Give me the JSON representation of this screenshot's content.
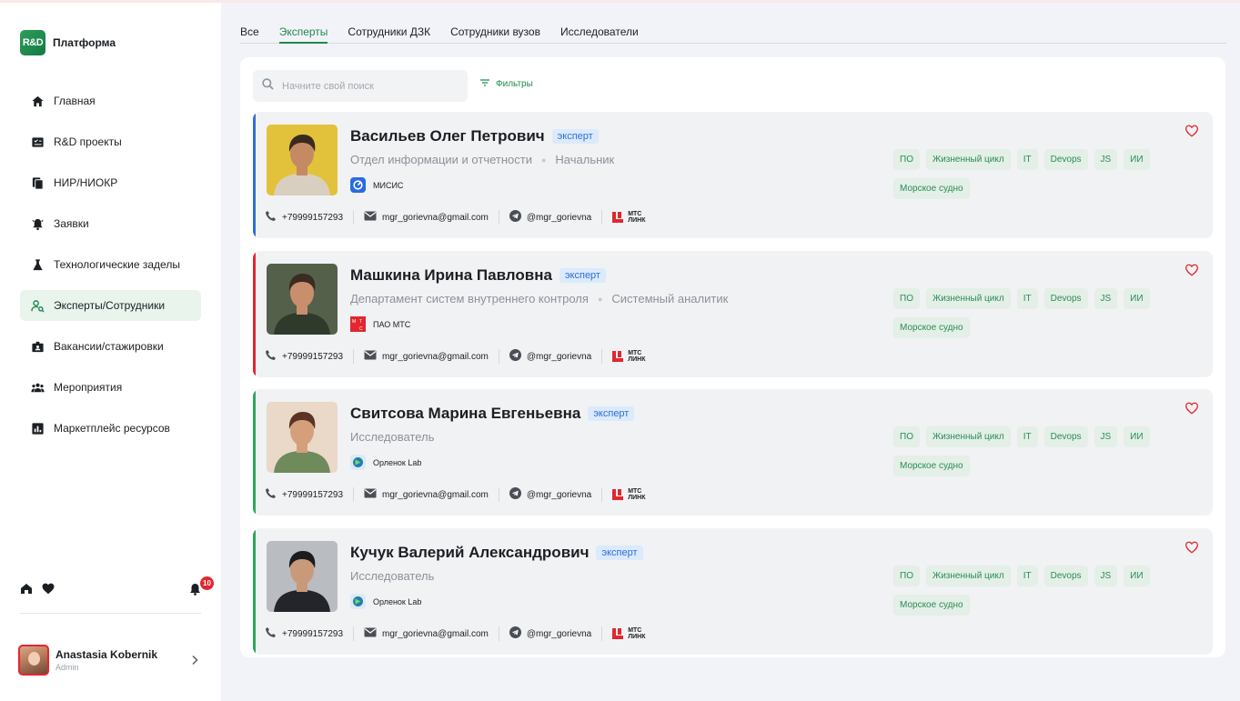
{
  "brand": {
    "logo_text": "R&D",
    "name": "Платформа"
  },
  "nav": [
    {
      "label": "Главная",
      "icon": "home-icon",
      "active": false
    },
    {
      "label": "R&D проекты",
      "icon": "projects-icon",
      "active": false
    },
    {
      "label": "НИР/НИОКР",
      "icon": "documents-icon",
      "active": false
    },
    {
      "label": "Заявки",
      "icon": "bell-alert-icon",
      "active": false
    },
    {
      "label": "Технологические заделы",
      "icon": "flask-icon",
      "active": false
    },
    {
      "label": "Эксперты/Сотрудники",
      "icon": "person-search-icon",
      "active": true
    },
    {
      "label": "Вакансии/стажировки",
      "icon": "badge-icon",
      "active": false
    },
    {
      "label": "Мероприятия",
      "icon": "group-icon",
      "active": false
    },
    {
      "label": "Маркетплейс ресурсов",
      "icon": "bar-chart-icon",
      "active": false
    }
  ],
  "notifications": {
    "count": "10"
  },
  "user": {
    "name": "Anastasia Kobernik",
    "role": "Admin"
  },
  "tabs": [
    {
      "label": "Все",
      "active": false
    },
    {
      "label": "Эксперты",
      "active": true
    },
    {
      "label": "Сотрудники ДЗК",
      "active": false
    },
    {
      "label": "Сотрудники вузов",
      "active": false
    },
    {
      "label": "Исследователи",
      "active": false
    }
  ],
  "search": {
    "placeholder": "Начните свой поиск",
    "value": ""
  },
  "filters_label": "Фильтры",
  "colors": {
    "accent_green": "#1f8a4c",
    "badge_blue": "#2f6fd6",
    "brand_red": "#e3262f"
  },
  "people": [
    {
      "name": "Васильев Олег Петрович",
      "badge": "эксперт",
      "department": "Отдел информации и отчетности",
      "position": "Начальник",
      "org": "МИСИС",
      "org_logo": "misis-logo",
      "accent": "#2f6fd6",
      "phone": "+79999157293",
      "email": "mgr_gorievna@gmail.com",
      "telegram": "@mgr_gorievna",
      "link_brand": [
        "МТС",
        "ЛИНК"
      ],
      "tags": [
        "ПО",
        "Жизненный цикл",
        "IT",
        "Devops",
        "JS",
        "ИИ",
        "Морское судно"
      ],
      "photo_colors": [
        "#e2c23a",
        "#3a2a1e",
        "#c48a63",
        "#d9cfc0"
      ]
    },
    {
      "name": "Машкина Ирина Павловна",
      "badge": "эксперт",
      "department": "Департамент систем внутреннего контроля",
      "position": "Системный аналитик",
      "org": "ПАО МТС",
      "org_logo": "mts-logo",
      "accent": "#e3262f",
      "phone": "+79999157293",
      "email": "mgr_gorievna@gmail.com",
      "telegram": "@mgr_gorievna",
      "link_brand": [
        "МТС",
        "ЛИНК"
      ],
      "tags": [
        "ПО",
        "Жизненный цикл",
        "IT",
        "Devops",
        "JS",
        "ИИ",
        "Морское судно"
      ],
      "photo_colors": [
        "#55604a",
        "#3b2b22",
        "#c98f6d",
        "#2f3a2c"
      ]
    },
    {
      "name": "Свитсова Марина Евгеньевна",
      "badge": "эксперт",
      "department": "Исследователь",
      "position": "",
      "org": "Орленок Lab",
      "org_logo": "orlenok-logo",
      "accent": "#2fa55a",
      "phone": "+79999157293",
      "email": "mgr_gorievna@gmail.com",
      "telegram": "@mgr_gorievna",
      "link_brand": [
        "МТС",
        "ЛИНК"
      ],
      "tags": [
        "ПО",
        "Жизненный цикл",
        "IT",
        "Devops",
        "JS",
        "ИИ",
        "Морское судно"
      ],
      "photo_colors": [
        "#ead9c8",
        "#5a3424",
        "#d69f7c",
        "#6f8a5b"
      ]
    },
    {
      "name": "Кучук Валерий Александрович",
      "badge": "эксперт",
      "department": "Исследователь",
      "position": "",
      "org": "Орленок Lab",
      "org_logo": "orlenok-logo",
      "accent": "#2fa55a",
      "phone": "+79999157293",
      "email": "mgr_gorievna@gmail.com",
      "telegram": "@mgr_gorievna",
      "link_brand": [
        "МТС",
        "ЛИНК"
      ],
      "tags": [
        "ПО",
        "Жизненный цикл",
        "IT",
        "Devops",
        "JS",
        "ИИ",
        "Морское судно"
      ],
      "photo_colors": [
        "#b9bcc0",
        "#1c1c1f",
        "#c99a7a",
        "#23252b"
      ]
    }
  ]
}
